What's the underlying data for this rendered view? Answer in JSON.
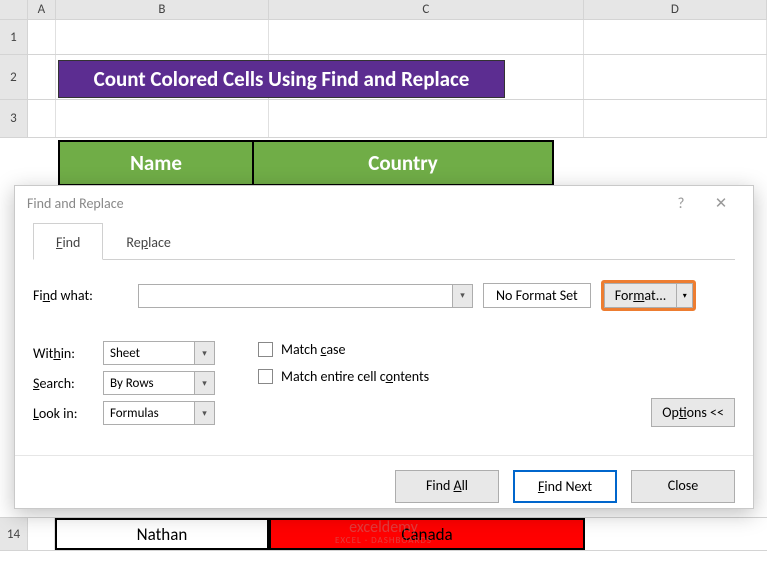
{
  "columns": [
    "A",
    "B",
    "C",
    "D"
  ],
  "row_labels": {
    "r1": "1",
    "r2": "2",
    "r3": "3",
    "r14": "14"
  },
  "banner_title": "Count Colored Cells Using Find and Replace",
  "table_headers": {
    "name": "Name",
    "country": "Country"
  },
  "row14": {
    "name": "Nathan",
    "country": "Canada"
  },
  "watermark": {
    "line1": "exceldemy",
    "line2": "EXCEL · DASHBOARDS"
  },
  "dialog": {
    "title": "Find and Replace",
    "tabs": {
      "find": "Find",
      "replace": "Replace"
    },
    "find_what_label": "Find what:",
    "find_what_value": "",
    "no_format": "No Format Set",
    "format_button": "Format...",
    "dropdowns": {
      "within_label": "Within:",
      "within_value": "Sheet",
      "search_label": "Search:",
      "search_value": "By Rows",
      "lookin_label": "Look in:",
      "lookin_value": "Formulas"
    },
    "checkboxes": {
      "match_case": "Match case",
      "match_entire": "Match entire cell contents"
    },
    "options_button": "Options <<",
    "buttons": {
      "find_all": "Find All",
      "find_next": "Find Next",
      "close": "Close"
    },
    "help_glyph": "?",
    "close_glyph": "✕",
    "arrow_glyph": "▾"
  }
}
